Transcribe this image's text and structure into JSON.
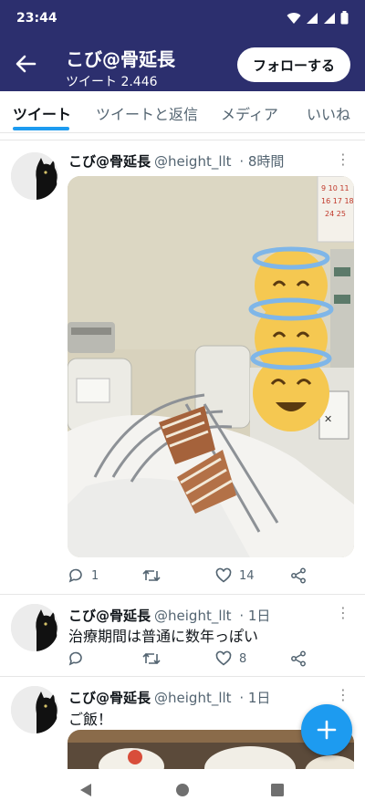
{
  "status": {
    "time": "23:44"
  },
  "header": {
    "display_name": "こび@骨延長",
    "tweet_count": "ツイート 2.446",
    "follow_label": "フォローする"
  },
  "tabs": [
    {
      "label": "ツイート",
      "active": true
    },
    {
      "label": "ツイートと返信",
      "active": false
    },
    {
      "label": "メディア",
      "active": false
    },
    {
      "label": "いいね",
      "active": false
    }
  ],
  "tweets": [
    {
      "name": "こび@骨延長",
      "handle": "@height_llt",
      "time": "8時間",
      "text": "",
      "replies": "1",
      "likes": "14"
    },
    {
      "name": "こび@骨延長",
      "handle": "@height_llt",
      "time": "1日",
      "text": "治療期間は普通に数年っぽい",
      "replies": "",
      "likes": "8"
    },
    {
      "name": "こび@骨延長",
      "handle": "@height_llt",
      "time": "1日",
      "text": "ご飯！"
    }
  ],
  "calendar": {
    "row1": "9 10 11",
    "row2": "16 17 18",
    "row3": "24 25"
  },
  "colors": {
    "header_bg": "#2c2f6e",
    "accent": "#1d9bf0"
  }
}
